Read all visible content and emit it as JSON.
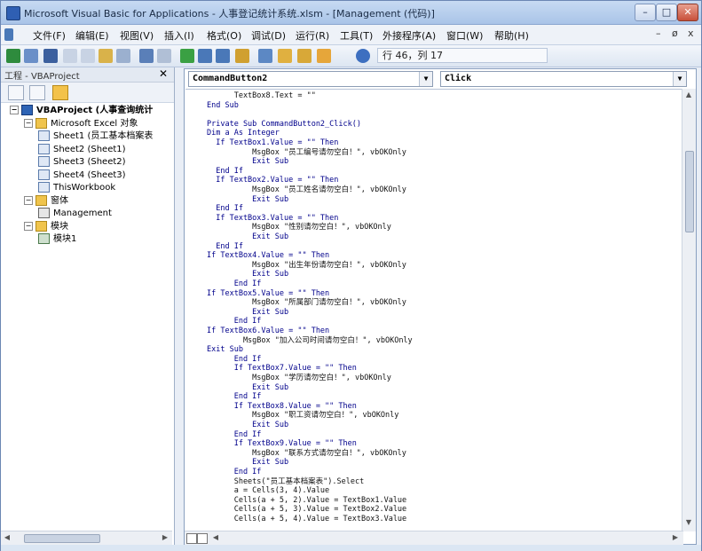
{
  "window": {
    "title": "Microsoft Visual Basic for Applications - 人事登记统计系统.xlsm - [Management (代码)]",
    "controls": {
      "minimize": "–",
      "maximize": "□",
      "close": "✕"
    }
  },
  "menu": {
    "items": [
      "文件(F)",
      "编辑(E)",
      "视图(V)",
      "插入(I)",
      "格式(O)",
      "调试(D)",
      "运行(R)",
      "工具(T)",
      "外接程序(A)",
      "窗口(W)",
      "帮助(H)"
    ],
    "mdi": {
      "minimize": "–",
      "restore": "ø",
      "close": "x"
    }
  },
  "toolbar": {
    "position_text": "行 46，列 17",
    "icons": [
      "excel-icon",
      "insert-userform-icon",
      "save-icon",
      "cut-icon",
      "copy-icon",
      "paste-icon",
      "find-icon",
      "undo-icon",
      "redo-icon",
      "run-icon",
      "break-icon",
      "reset-icon",
      "design-mode-icon",
      "project-explorer-icon",
      "properties-icon",
      "object-browser-icon",
      "toolbox-icon",
      "help-icon"
    ]
  },
  "project_pane": {
    "title": "工程 - VBAProject",
    "close": "✕",
    "tree": [
      {
        "label": "VBAProject (人事查询统计",
        "level": 0,
        "expander": "−",
        "icon": "proj",
        "bold": true
      },
      {
        "label": "Microsoft Excel 对象",
        "level": 1,
        "expander": "−",
        "icon": "folder"
      },
      {
        "label": "Sheet1 (员工基本档案表",
        "level": 2,
        "icon": "sheet"
      },
      {
        "label": "Sheet2 (Sheet1)",
        "level": 2,
        "icon": "sheet"
      },
      {
        "label": "Sheet3 (Sheet2)",
        "level": 2,
        "icon": "sheet"
      },
      {
        "label": "Sheet4 (Sheet3)",
        "level": 2,
        "icon": "sheet"
      },
      {
        "label": "ThisWorkbook",
        "level": 2,
        "icon": "sheet"
      },
      {
        "label": "窗体",
        "level": 1,
        "expander": "−",
        "icon": "folder"
      },
      {
        "label": "Management",
        "level": 2,
        "icon": "form"
      },
      {
        "label": "模块",
        "level": 1,
        "expander": "−",
        "icon": "folder"
      },
      {
        "label": "模块1",
        "level": 2,
        "icon": "mod"
      }
    ]
  },
  "code_window": {
    "object_combo": "CommandButton2",
    "proc_combo": "Click",
    "lines": [
      "      TextBox8.Text = \"\"",
      "End Sub",
      "",
      "Private Sub CommandButton2_Click()",
      "Dim a As Integer",
      "  If TextBox1.Value = \"\" Then",
      "          MsgBox \"员工编号请勿空白！\", vbOKOnly",
      "          Exit Sub",
      "  End If",
      "  If TextBox2.Value = \"\" Then",
      "          MsgBox \"员工姓名请勿空白！\", vbOKOnly",
      "          Exit Sub",
      "  End If",
      "  If TextBox3.Value = \"\" Then",
      "          MsgBox \"性别请勿空白！\", vbOKOnly",
      "          Exit Sub",
      "  End If",
      "If TextBox4.Value = \"\" Then",
      "          MsgBox \"出生年份请勿空白！\", vbOKOnly",
      "          Exit Sub",
      "      End If",
      "If TextBox5.Value = \"\" Then",
      "          MsgBox \"所属部门请勿空白！\", vbOKOnly",
      "          Exit Sub",
      "      End If",
      "If TextBox6.Value = \"\" Then",
      "        MsgBox \"加入公司时间请勿空白！\", vbOKOnly",
      "Exit Sub",
      "      End If",
      "      If TextBox7.Value = \"\" Then",
      "          MsgBox \"学历请勿空白！\", vbOKOnly",
      "          Exit Sub",
      "      End If",
      "      If TextBox8.Value = \"\" Then",
      "          MsgBox \"职工资请勿空白！\", vbOKOnly",
      "          Exit Sub",
      "      End If",
      "      If TextBox9.Value = \"\" Then",
      "          MsgBox \"联系方式请勿空白！\", vbOKOnly",
      "          Exit Sub",
      "      End If",
      "      Sheets(\"员工基本档案表\").Select",
      "      a = Cells(3, 4).Value",
      "      Cells(a + 5, 2).Value = TextBox1.Value",
      "      Cells(a + 5, 3).Value = TextBox2.Value",
      "      Cells(a + 5, 4).Value = TextBox3.Value"
    ]
  }
}
